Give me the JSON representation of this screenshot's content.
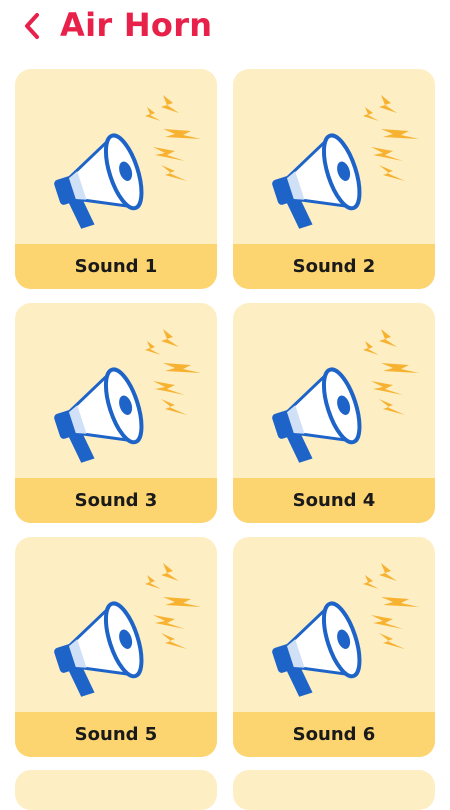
{
  "header": {
    "title": "Air Horn",
    "back_icon": "chevron-left-icon"
  },
  "colors": {
    "accent": "#e8214a",
    "card_bg": "#fdeec4",
    "label_bg": "#fcd470",
    "megaphone_blue": "#1e64c8",
    "sound_waves": "#f7b231"
  },
  "sounds": [
    {
      "label": "Sound 1",
      "icon": "megaphone-icon"
    },
    {
      "label": "Sound 2",
      "icon": "megaphone-icon"
    },
    {
      "label": "Sound 3",
      "icon": "megaphone-icon"
    },
    {
      "label": "Sound 4",
      "icon": "megaphone-icon"
    },
    {
      "label": "Sound 5",
      "icon": "megaphone-icon"
    },
    {
      "label": "Sound 6",
      "icon": "megaphone-icon"
    }
  ]
}
